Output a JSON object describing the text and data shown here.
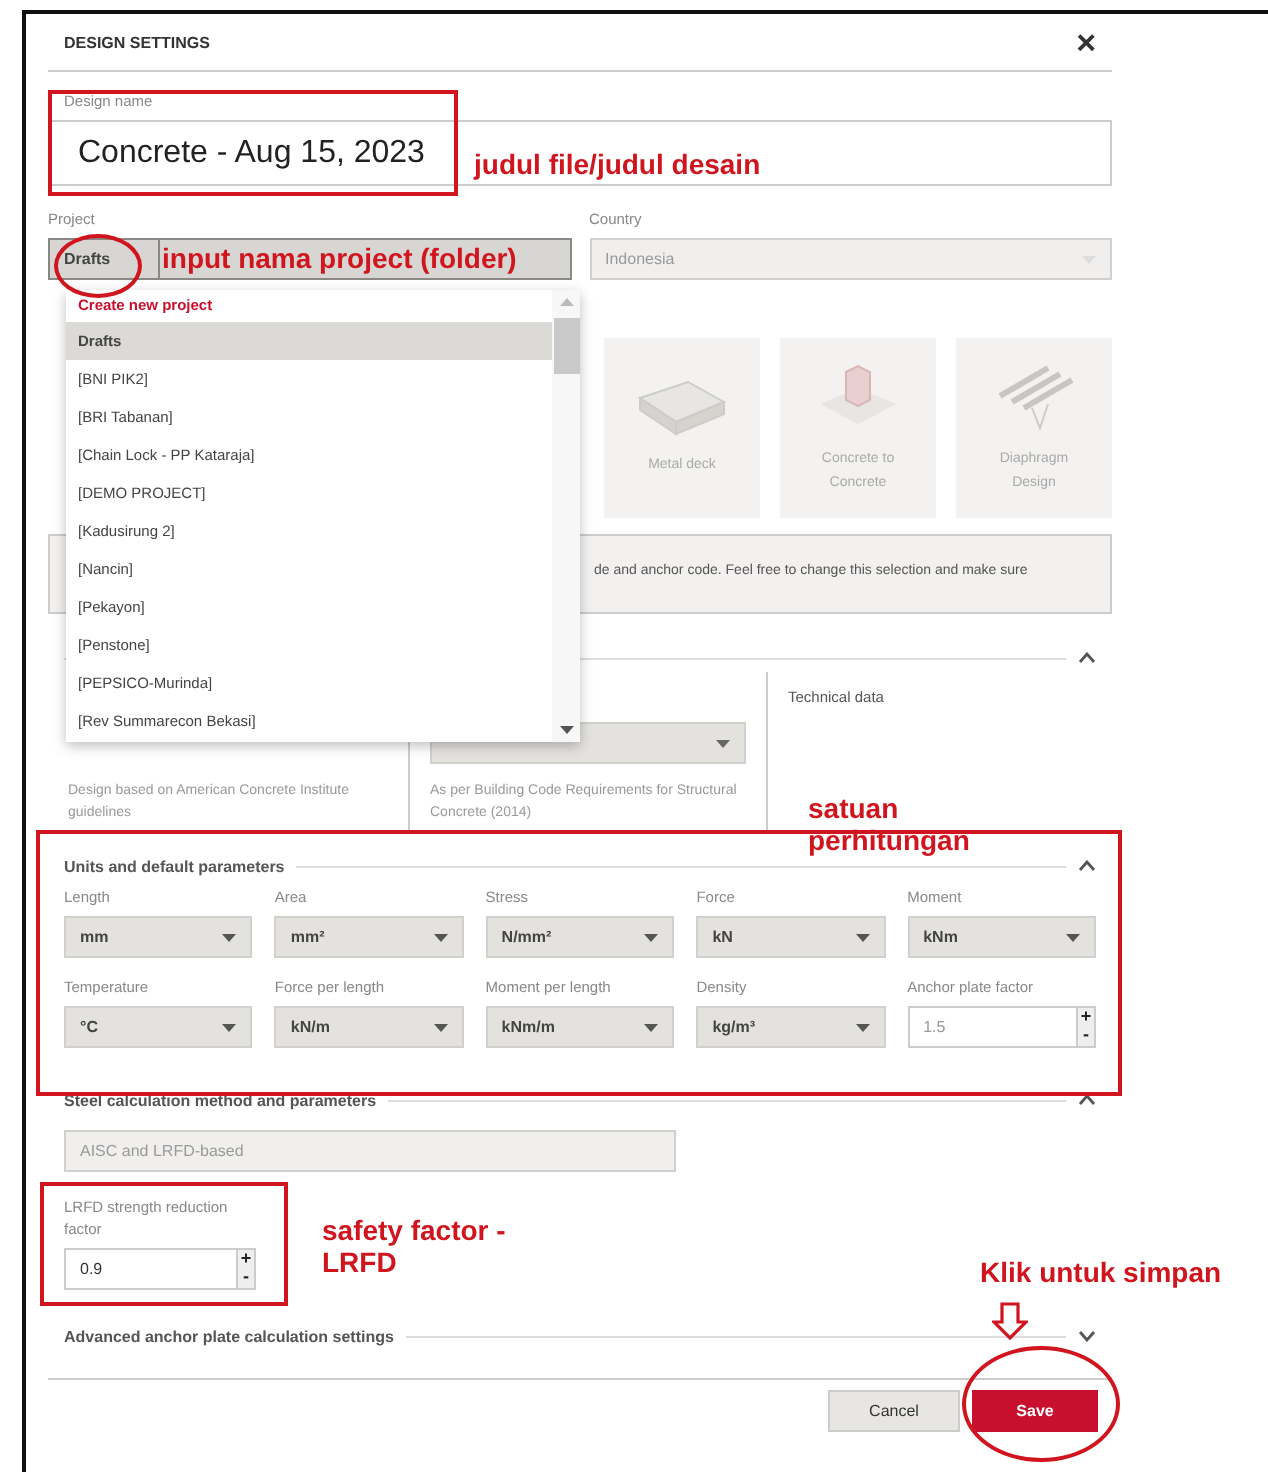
{
  "dialog": {
    "title": "DESIGN SETTINGS",
    "close": "×"
  },
  "design_name": {
    "label": "Design name",
    "value": "Concrete - Aug 15, 2023"
  },
  "project": {
    "label": "Project",
    "value": "Drafts",
    "open": true
  },
  "country": {
    "label": "Country",
    "value": "Indonesia",
    "disabled": true
  },
  "project_dropdown": {
    "items": [
      {
        "label": "Create new project",
        "kind": "action",
        "selected": false
      },
      {
        "label": "Drafts",
        "kind": "option",
        "selected": true
      },
      {
        "label": "[BNI PIK2]",
        "kind": "option",
        "selected": false
      },
      {
        "label": "[BRI Tabanan]",
        "kind": "option",
        "selected": false
      },
      {
        "label": "[Chain Lock - PP Kataraja]",
        "kind": "option",
        "selected": false
      },
      {
        "label": "[DEMO PROJECT]",
        "kind": "option",
        "selected": false
      },
      {
        "label": "[Kadusirung 2]",
        "kind": "option",
        "selected": false
      },
      {
        "label": "[Nancin]",
        "kind": "option",
        "selected": false
      },
      {
        "label": "[Pekayon]",
        "kind": "option",
        "selected": false
      },
      {
        "label": "[Penstone]",
        "kind": "option",
        "selected": false
      },
      {
        "label": "[PEPSICO-Murinda]",
        "kind": "option",
        "selected": false
      },
      {
        "label": "[Rev Summarecon Bekasi]",
        "kind": "option",
        "selected": false
      }
    ]
  },
  "design_types": [
    {
      "label": "Metal deck",
      "kind": "deck"
    },
    {
      "label": "Concrete to Concrete",
      "kind": "block"
    },
    {
      "label": "Diaphragm Design",
      "kind": "diaphragm"
    }
  ],
  "info_text": "de and anchor code. Feel free to change this selection and make sure",
  "design_code": {
    "expanded": true,
    "columns": [
      {
        "text": "Design based on American Concrete Institute guidelines"
      },
      {
        "text": "As per Building Code Requirements for Structural Concrete (2014)"
      },
      {
        "heading": "Technical data"
      }
    ]
  },
  "units": {
    "title": "Units and default parameters",
    "expanded": true,
    "fields": [
      {
        "label": "Length",
        "value": "mm",
        "kind": "select"
      },
      {
        "label": "Area",
        "value": "mm²",
        "kind": "select"
      },
      {
        "label": "Stress",
        "value": "N/mm²",
        "kind": "select"
      },
      {
        "label": "Force",
        "value": "kN",
        "kind": "select"
      },
      {
        "label": "Moment",
        "value": "kNm",
        "kind": "select"
      },
      {
        "label": "Temperature",
        "value": "°C",
        "kind": "select"
      },
      {
        "label": "Force per length",
        "value": "kN/m",
        "kind": "select"
      },
      {
        "label": "Moment per length",
        "value": "kNm/m",
        "kind": "select"
      },
      {
        "label": "Density",
        "value": "kg/m³",
        "kind": "select"
      },
      {
        "label": "Anchor plate factor",
        "value": "1.5",
        "kind": "number",
        "step_up": "+",
        "step_down": "-"
      }
    ]
  },
  "steel": {
    "title": "Steel calculation method and parameters",
    "expanded": true,
    "method": {
      "value": "AISC and LRFD-based",
      "disabled": true
    },
    "factor": {
      "label": "LRFD strength reduction factor",
      "value": "0.9",
      "step_up": "+",
      "step_down": "-"
    }
  },
  "advanced": {
    "title": "Advanced anchor plate calculation settings",
    "expanded": false
  },
  "buttons": [
    {
      "label": "Cancel",
      "kind": "secondary"
    },
    {
      "label": "Save",
      "kind": "primary"
    }
  ],
  "annotations": [
    {
      "text": "judul file/judul desain"
    },
    {
      "text": "input nama project (folder)"
    },
    {
      "text": "satuan perhitungan"
    },
    {
      "text": "safety factor - LRFD"
    },
    {
      "text": "Klik untuk simpan"
    }
  ]
}
